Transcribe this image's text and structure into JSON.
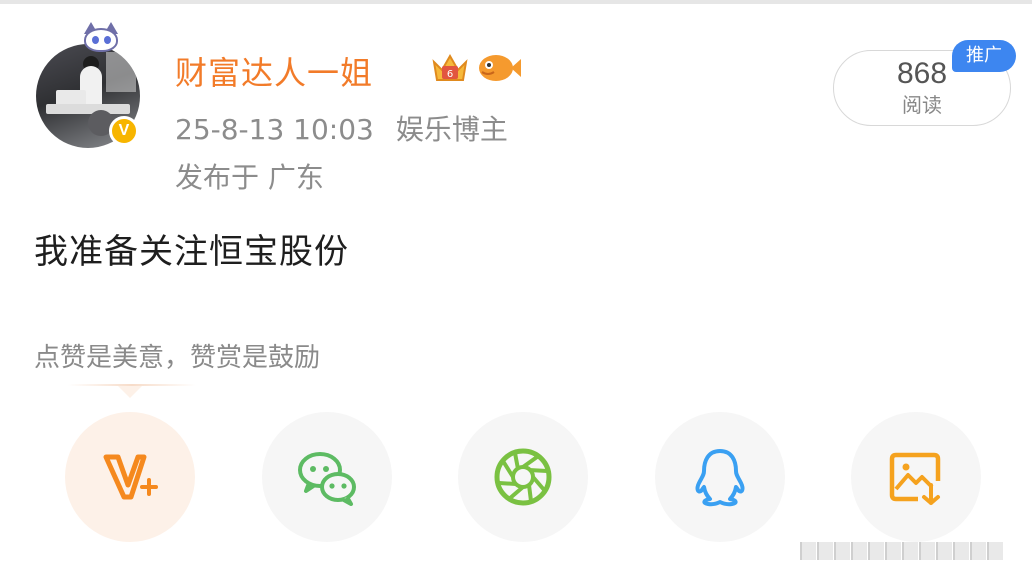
{
  "user": {
    "name": "财富达人一姐",
    "verified_badge": "V"
  },
  "meta": {
    "timestamp": "25-8-13 10:03",
    "role": "娱乐博主",
    "location": "发布于 广东"
  },
  "reads": {
    "count": "868",
    "label": "阅读",
    "promo_tag": "推广"
  },
  "post": {
    "text": "我准备关注恒宝股份"
  },
  "reward_hint": "点赞是美意，赞赏是鼓励",
  "share_buttons": [
    {
      "icon": "reward-v-plus-icon",
      "color": "#f5891e"
    },
    {
      "icon": "wechat-icon",
      "color": "#5dbb63"
    },
    {
      "icon": "moments-aperture-icon",
      "color": "#7ac142"
    },
    {
      "icon": "qq-penguin-icon",
      "color": "#3aa0f2"
    },
    {
      "icon": "save-image-icon",
      "color": "#f5a21e"
    }
  ],
  "colors": {
    "username": "#f27b29",
    "promo_bg": "#3d86f0",
    "verified": "#f7b500"
  }
}
